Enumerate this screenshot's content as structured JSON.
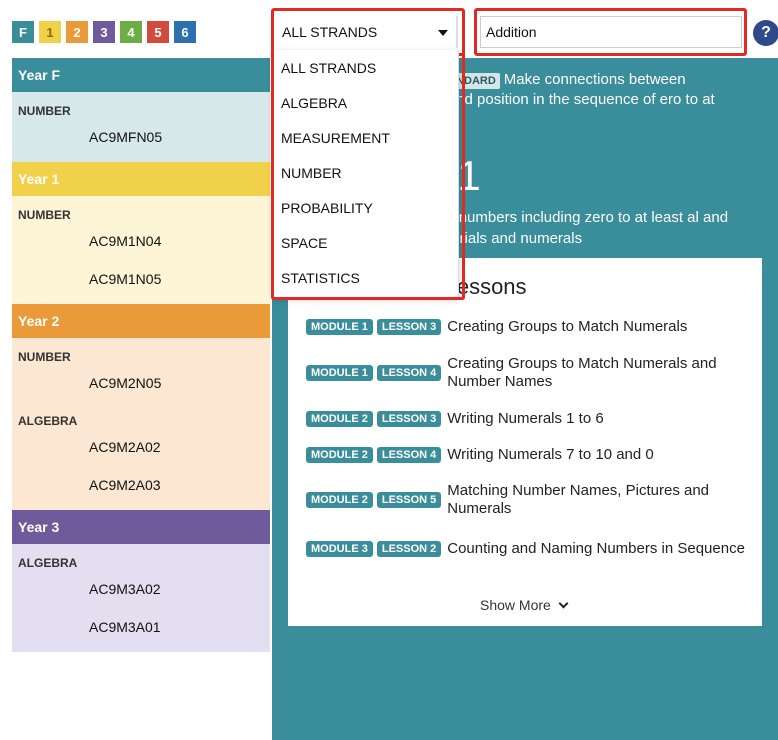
{
  "year_tabs": [
    {
      "label": "F",
      "color": "#3a8d9b"
    },
    {
      "label": "1",
      "color": "#f2d14a"
    },
    {
      "label": "2",
      "color": "#eb9a3a"
    },
    {
      "label": "3",
      "color": "#6f5a9b"
    },
    {
      "label": "4",
      "color": "#6aae45"
    },
    {
      "label": "5",
      "color": "#d24b3c"
    },
    {
      "label": "6",
      "color": "#2e6fb0"
    }
  ],
  "strand_select": {
    "value": "ALL STRANDS"
  },
  "search": {
    "value": "Addition"
  },
  "help": {
    "label": "?"
  },
  "dropdown_options": [
    "ALL STRANDS",
    "ALGEBRA",
    "MEASUREMENT",
    "NUMBER",
    "PROBABILITY",
    "SPACE",
    "STATISTICS"
  ],
  "sidebar": {
    "years": [
      {
        "title": "Year F",
        "head_color": "#3a8d9b",
        "bg": "#d7e8eb",
        "groups": [
          {
            "strand": "NUMBER",
            "codes": [
              "AC9MFN05"
            ]
          }
        ]
      },
      {
        "title": "Year 1",
        "head_color": "#f2d14a",
        "bg": "#fdf5d6",
        "groups": [
          {
            "strand": "NUMBER",
            "codes": [
              "AC9M1N04",
              "AC9M1N05"
            ]
          }
        ]
      },
      {
        "title": "Year 2",
        "head_color": "#eb9a3a",
        "bg": "#fce7d2",
        "groups": [
          {
            "strand": "NUMBER",
            "codes": [
              "AC9M2N05"
            ]
          },
          {
            "strand": "ALGEBRA",
            "codes": [
              "AC9M2A02",
              "AC9M2A03"
            ]
          }
        ]
      },
      {
        "title": "Year 3",
        "head_color": "#6f5a9b",
        "bg": "#e3dff0",
        "groups": [
          {
            "strand": "ALGEBRA",
            "codes": [
              "AC9M3A02",
              "AC9M3A01"
            ]
          }
        ]
      }
    ]
  },
  "standard": {
    "badge": "VEMENT STANDARD",
    "text": "Make connections between numerals and position in the sequence of ero to at least 20",
    "code": "FN01",
    "description": "t and order numbers including zero to at least al and virtual materials and numerals"
  },
  "lessons": {
    "title": "Stones Lessons",
    "items": [
      {
        "module": "MODULE 1",
        "lesson": "LESSON 3",
        "name": "Creating Groups to Match Numerals"
      },
      {
        "module": "MODULE 1",
        "lesson": "LESSON 4",
        "name": "Creating Groups to Match Numerals and Number Names"
      },
      {
        "module": "MODULE 2",
        "lesson": "LESSON 3",
        "name": "Writing Numerals 1 to 6"
      },
      {
        "module": "MODULE 2",
        "lesson": "LESSON 4",
        "name": "Writing Numerals 7 to 10 and 0"
      },
      {
        "module": "MODULE 2",
        "lesson": "LESSON 5",
        "name": "Matching Number Names, Pictures and Numerals"
      },
      {
        "module": "MODULE 3",
        "lesson": "LESSON 2",
        "name": "Counting and Naming Numbers in Sequence"
      }
    ],
    "show_more": "Show More"
  }
}
